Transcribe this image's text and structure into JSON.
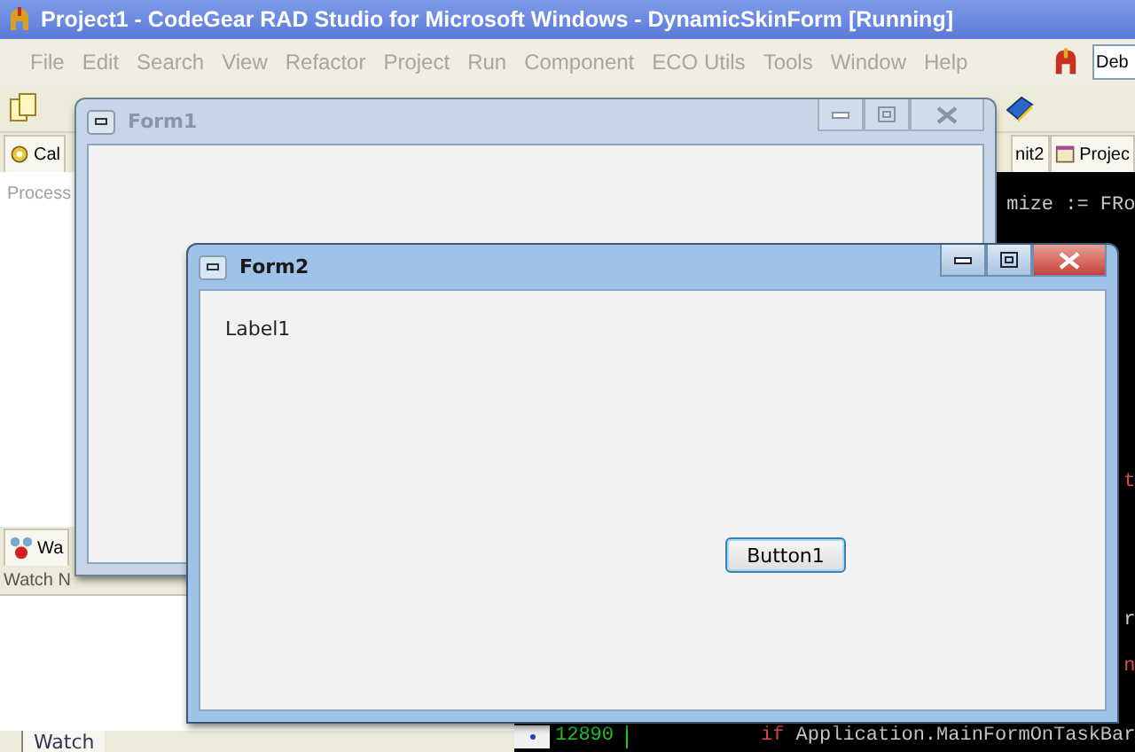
{
  "ide": {
    "title": "Project1 - CodeGear RAD Studio for Microsoft Windows - DynamicSkinForm [Running]",
    "menu": [
      {
        "label": "File",
        "disabled": true
      },
      {
        "label": "Edit",
        "disabled": true
      },
      {
        "label": "Search",
        "disabled": true
      },
      {
        "label": "View",
        "disabled": true
      },
      {
        "label": "Refactor",
        "disabled": true
      },
      {
        "label": "Project",
        "disabled": true
      },
      {
        "label": "Run",
        "disabled": true
      },
      {
        "label": "Component",
        "disabled": true
      },
      {
        "label": "ECO Utils",
        "disabled": true
      },
      {
        "label": "Tools",
        "disabled": true
      },
      {
        "label": "Window",
        "disabled": true
      },
      {
        "label": "Help",
        "disabled": true
      }
    ],
    "config_combo": {
      "value": "Deb"
    },
    "left_tab": "Cal",
    "process_label": "Process",
    "watch_tab": "Wa",
    "watch_column": "Watch N",
    "bottom_tab": "Watch",
    "editor_tabs": [
      "nit2",
      "Projec"
    ],
    "code_lines": [
      {
        "kind": "edge",
        "segments": [
          {
            "text": "mize := FRo",
            "color": "#c8c8c8"
          }
        ]
      },
      {
        "kind": "edge",
        "segments": [
          {
            "text": "t",
            "color": "#e04848"
          }
        ]
      },
      {
        "kind": "edge",
        "segments": [
          {
            "text": "r",
            "color": "#c8c8c8"
          }
        ]
      },
      {
        "kind": "edge",
        "segments": [
          {
            "text": "n",
            "color": "#e04848"
          }
        ]
      },
      {
        "kind": "line",
        "number": "12890",
        "segments": [
          {
            "text": "if",
            "color": "#e04848"
          },
          {
            "text": " Application.MainFormOnTaskBar",
            "color": "#c8c8c8"
          }
        ]
      }
    ]
  },
  "windows": [
    {
      "title": "Form1",
      "active": false
    },
    {
      "title": "Form2",
      "active": true,
      "label": "Label1",
      "button": "Button1"
    }
  ]
}
